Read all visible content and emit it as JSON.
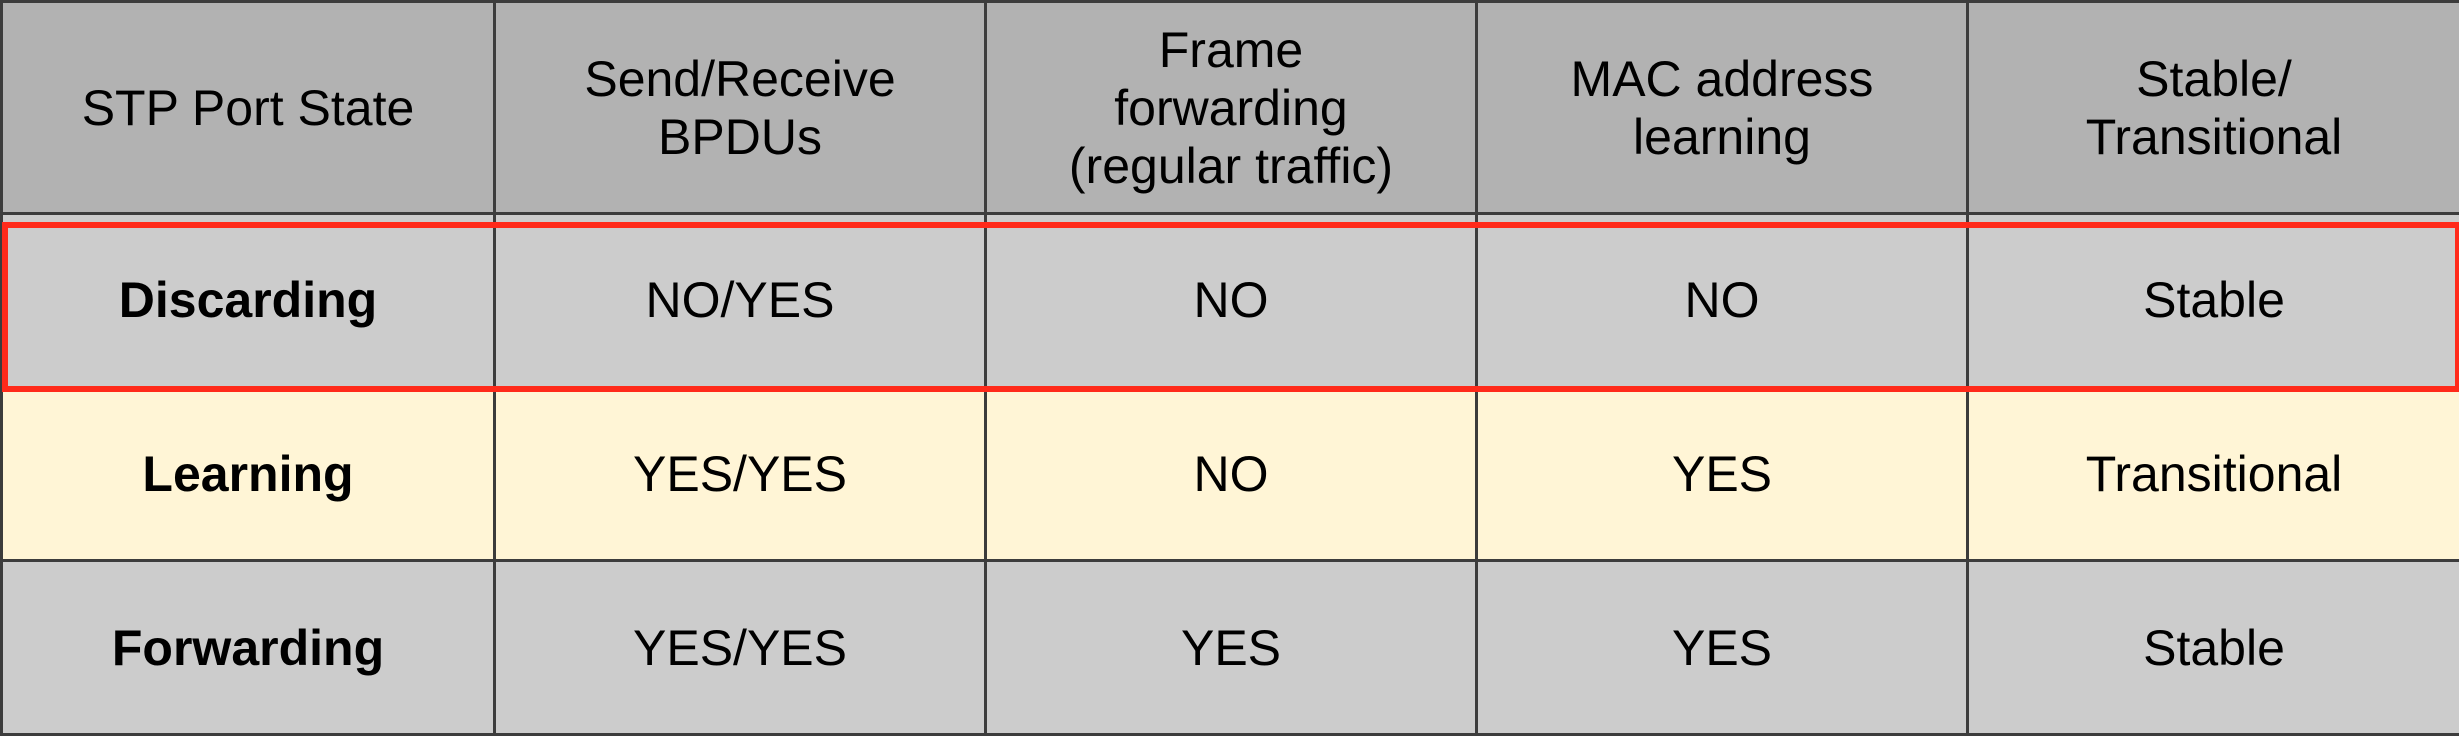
{
  "table": {
    "headers": [
      "STP Port State",
      "Send/Receive\nBPDUs",
      "Frame\nforwarding\n(regular traffic)",
      "MAC address\nlearning",
      "Stable/\nTransitional"
    ],
    "rows": [
      [
        "Discarding",
        "NO/YES",
        "NO",
        "NO",
        "Stable"
      ],
      [
        "Learning",
        "YES/YES",
        "NO",
        "YES",
        "Transitional"
      ],
      [
        "Forwarding",
        "YES/YES",
        "YES",
        "YES",
        "Stable"
      ]
    ]
  },
  "colors": {
    "header_bg": "#b2b2b2",
    "row_grey_bg": "#cccccc",
    "row_cream_bg": "#fff5d6",
    "highlight_border": "#ff2a1a",
    "grid_line": "#3c3c3c"
  }
}
